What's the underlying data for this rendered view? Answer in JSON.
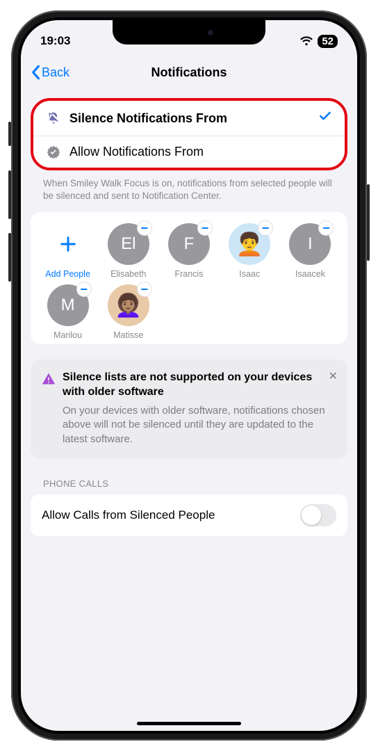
{
  "status": {
    "time": "19:03",
    "battery": "52"
  },
  "nav": {
    "back": "Back",
    "title": "Notifications"
  },
  "options": {
    "silence": {
      "label": "Silence Notifications From",
      "selected": true
    },
    "allow": {
      "label": "Allow Notifications From",
      "selected": false
    },
    "footer": "When Smiley Walk Focus is on, notifications from selected people will be silenced and sent to Notification Center."
  },
  "people": {
    "add_label": "Add People",
    "items": [
      {
        "name": "Elisabeth",
        "initials": "El",
        "type": "initials"
      },
      {
        "name": "Francis",
        "initials": "F",
        "type": "initials"
      },
      {
        "name": "Isaac",
        "initials": "",
        "type": "memoji1"
      },
      {
        "name": "Isaacek",
        "initials": "I",
        "type": "initials"
      },
      {
        "name": "Marilou",
        "initials": "M",
        "type": "initials"
      },
      {
        "name": "Matisse",
        "initials": "",
        "type": "memoji2"
      }
    ]
  },
  "notice": {
    "title": "Silence lists are not supported on your devices with older software",
    "body": "On your devices with older software, notifications chosen above will not be silenced until they are updated to the latest software."
  },
  "phone": {
    "section": "Phone Calls",
    "allow_calls": "Allow Calls from Silenced People"
  }
}
